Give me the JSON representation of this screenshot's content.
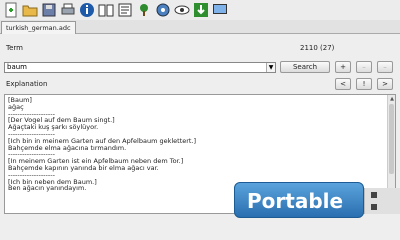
{
  "toolbar": {
    "buttons": [
      {
        "name": "new-icon"
      },
      {
        "name": "open-folder-icon"
      },
      {
        "name": "save-icon"
      },
      {
        "name": "print-icon"
      },
      {
        "name": "info-icon"
      },
      {
        "name": "book-icon"
      },
      {
        "name": "vocabulary-icon"
      },
      {
        "name": "tree-icon"
      },
      {
        "name": "settings-icon"
      },
      {
        "name": "view-icon"
      },
      {
        "name": "download-icon"
      },
      {
        "name": "screen-icon"
      }
    ]
  },
  "tab": {
    "label": "turkish_german.adc"
  },
  "term": {
    "label": "Term",
    "count": "2110 (27)",
    "value": "baum"
  },
  "buttons": {
    "search": "Search",
    "plus": "+",
    "minus": "–",
    "dash": "–",
    "prev": "<",
    "bang": "!",
    "next": ">"
  },
  "explanation": {
    "label": "Explanation",
    "lines": [
      "[Baum]",
      "ağaç",
      "--------------------",
      "[Der Vogel auf dem Baum singt.]",
      "Ağaçtaki kuş şarkı söylüyor.",
      "--------------------",
      "[Ich bin in meinem Garten auf den Apfelbaum geklettert.]",
      "Bahçemde elma ağacına tırmandım.",
      "--------------------",
      "[In meinem Garten ist ein Apfelbaum neben dem Tor.]",
      "Bahçemde kapının yanında bir elma ağacı var.",
      "--------------------",
      "[Ich bin neben dem Baum.]",
      "Ben ağacın yanındayım."
    ]
  },
  "badge": {
    "text": "Portable"
  },
  "colors": {
    "badge": "#3b87c9",
    "background": "#eeeeee"
  }
}
